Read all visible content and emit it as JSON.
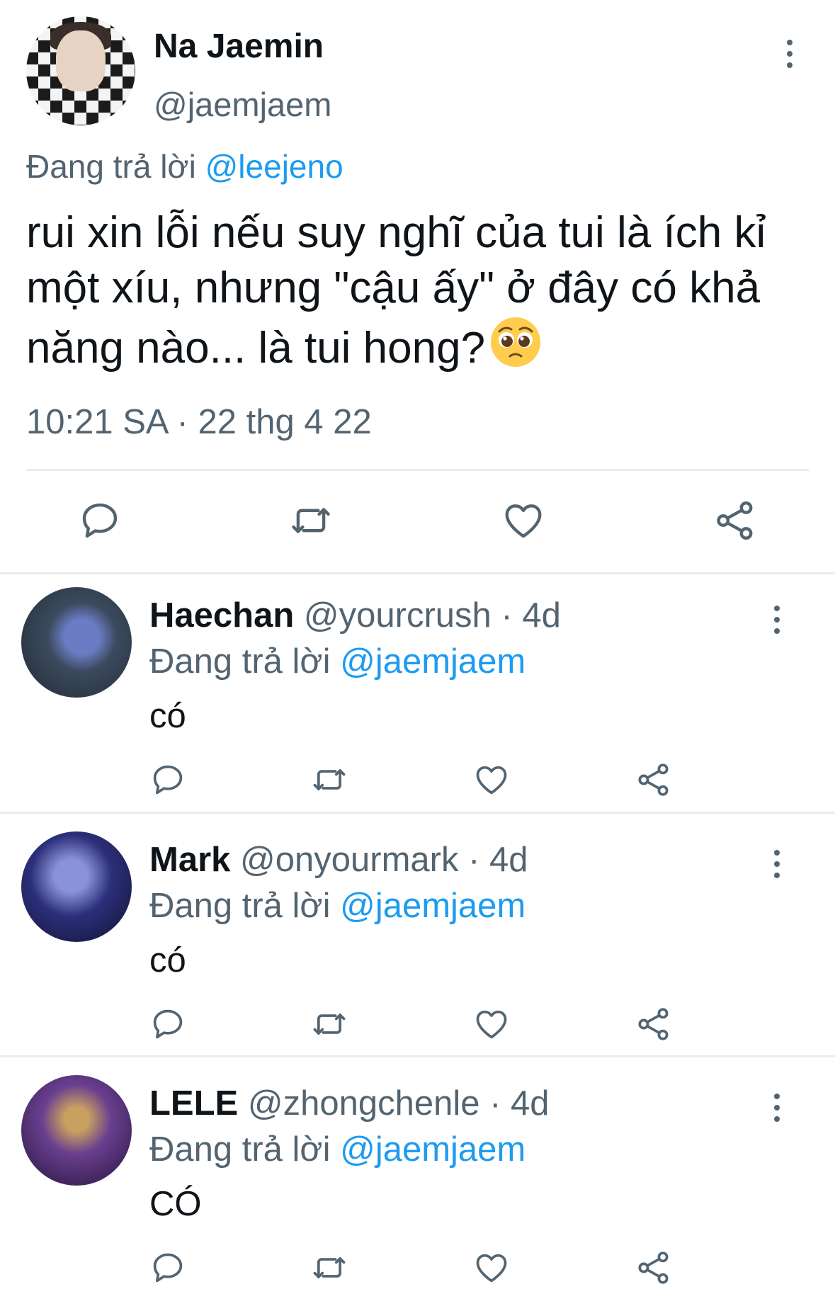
{
  "main_tweet": {
    "author_name": "Na Jaemin",
    "author_handle": "@jaemjaem",
    "replying_prefix": "Đang trả lời",
    "replying_to": "@leejeno",
    "text": "rui xin lỗi nếu suy nghĩ của tui là ích kỉ một xíu, nhưng \"cậu ấy\" ở đây có khả năng nào... là tui hong?",
    "emoji": "pleading-face",
    "time": "10:21 SA",
    "separator": "·",
    "date": "22 thg 4 22",
    "actions": [
      "reply-icon",
      "retweet-icon",
      "like-icon",
      "share-icon"
    ]
  },
  "replies": [
    {
      "name": "Haechan",
      "handle": "@yourcrush",
      "age": "· 4d",
      "replying_prefix": "Đang trả lời",
      "replying_to": "@jaemjaem",
      "text": "có",
      "avatar_color": "#3b4a5e"
    },
    {
      "name": "Mark",
      "handle": "@onyourmark",
      "age": "· 4d",
      "replying_prefix": "Đang trả lời",
      "replying_to": "@jaemjaem",
      "text": "có",
      "avatar_color": "#2c2f7a"
    },
    {
      "name": "LELE",
      "handle": "@zhongchenle",
      "age": "· 4d",
      "replying_prefix": "Đang trả lời",
      "replying_to": "@jaemjaem",
      "text": "CÓ",
      "avatar_color": "#4a2f6b"
    }
  ],
  "colors": {
    "text": "#0f1419",
    "secondary": "#536471",
    "mention": "#1d9bf0",
    "divider": "#e6ecf0"
  }
}
